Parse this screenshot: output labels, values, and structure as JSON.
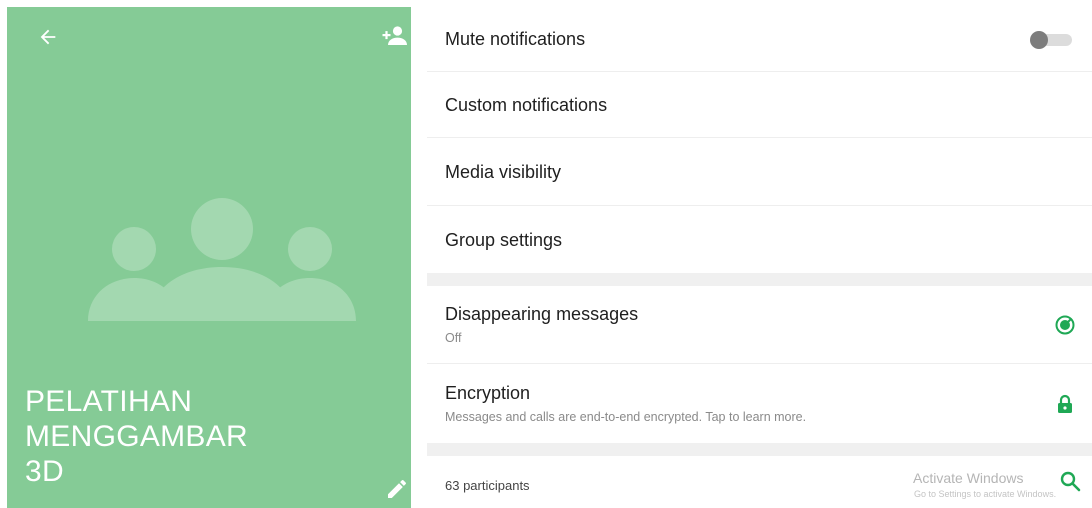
{
  "header": {
    "group_name": "PELATIHAN\nMENGGAMBAR\n3D"
  },
  "settings": {
    "mute": {
      "label": "Mute notifications",
      "enabled": false
    },
    "custom": {
      "label": "Custom notifications"
    },
    "media": {
      "label": "Media visibility"
    },
    "group_settings": {
      "label": "Group settings"
    },
    "disappearing": {
      "label": "Disappearing messages",
      "value": "Off"
    },
    "encryption": {
      "label": "Encryption",
      "description": "Messages and calls are end-to-end encrypted. Tap to learn more."
    }
  },
  "participants": {
    "count_label": "63 participants"
  },
  "watermark": {
    "title": "Activate Windows",
    "subtitle": "Go to Settings to activate Windows."
  },
  "colors": {
    "header_bg": "#85cb96",
    "accent": "#1fa855",
    "avatar_shape": "#a3d8b0"
  },
  "icons": {
    "back": "arrow-left-icon",
    "add_participant": "add-person-icon",
    "avatar": "group-avatar-icon",
    "edit": "pencil-icon",
    "disappearing": "timer-icon",
    "encryption": "lock-icon",
    "search": "search-icon"
  }
}
